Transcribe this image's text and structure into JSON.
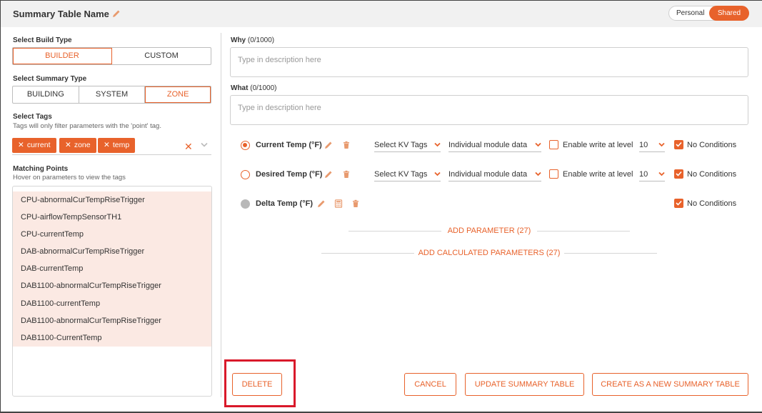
{
  "header": {
    "title": "Summary Table Name",
    "toggle": {
      "personal": "Personal",
      "shared": "Shared",
      "active": "shared"
    }
  },
  "left": {
    "build_type": {
      "label": "Select Build Type",
      "options": [
        "BUILDER",
        "CUSTOM"
      ],
      "active": "BUILDER"
    },
    "summary_type": {
      "label": "Select Summary Type",
      "options": [
        "BUILDING",
        "SYSTEM",
        "ZONE"
      ],
      "active": "ZONE"
    },
    "tags": {
      "label": "Select Tags",
      "hint": "Tags will only filter parameters with the 'point' tag.",
      "chips": [
        "current",
        "zone",
        "temp"
      ]
    },
    "matching": {
      "label": "Matching Points",
      "hint": "Hover on parameters to view the tags",
      "items": [
        "CPU-abnormalCurTempRiseTrigger",
        "CPU-airflowTempSensorTH1",
        "CPU-currentTemp",
        "DAB-abnormalCurTempRiseTrigger",
        "DAB-currentTemp",
        "DAB1100-abnormalCurTempRiseTrigger",
        "DAB1100-currentTemp",
        "DAB1100-abnormalCurTempRiseTrigger",
        "DAB1100-CurrentTemp"
      ]
    }
  },
  "right": {
    "why": {
      "label": "Why",
      "count": "(0/1000)",
      "placeholder": "Type in description here"
    },
    "what": {
      "label": "What",
      "count": "(0/1000)",
      "placeholder": "Type in description here"
    },
    "params": [
      {
        "name": "Current Temp (°F)",
        "kv": "Select KV Tags",
        "module": "Individual module data",
        "write_label": "Enable write at level",
        "level": "10",
        "conditions": "No Conditions"
      },
      {
        "name": "Desired Temp (°F)",
        "kv": "Select KV Tags",
        "module": "Individual module data",
        "write_label": "Enable write at level",
        "level": "10",
        "conditions": "No Conditions"
      },
      {
        "name": "Delta Temp (°F)",
        "conditions": "No Conditions"
      }
    ],
    "add_parameter": "ADD PARAMETER (27)",
    "add_calculated": "ADD CALCULATED PARAMETERS (27)"
  },
  "footer": {
    "delete": "DELETE",
    "cancel": "CANCEL",
    "update": "UPDATE SUMMARY TABLE",
    "create_new": "CREATE AS A NEW SUMMARY TABLE"
  },
  "colors": {
    "accent": "#e8622b",
    "highlight": "#d9192a",
    "list_bg": "#fbe9e3"
  }
}
